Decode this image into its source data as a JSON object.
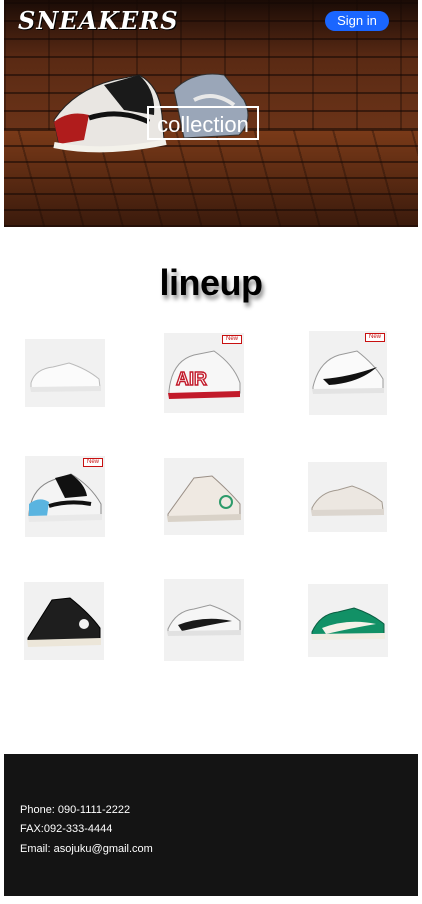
{
  "header": {
    "logo": "SNEAKERS",
    "signin_label": "Sign in"
  },
  "hero": {
    "collection_label": "collection"
  },
  "lineup": {
    "title": "lineup",
    "products": [
      {
        "badge": ""
      },
      {
        "badge": "New"
      },
      {
        "badge": "New"
      },
      {
        "badge": "New"
      },
      {
        "badge": ""
      },
      {
        "badge": ""
      },
      {
        "badge": ""
      },
      {
        "badge": ""
      },
      {
        "badge": ""
      }
    ]
  },
  "footer": {
    "phone": "Phone: 090-1111-2222",
    "fax": "FAX:092-333-4444",
    "email": "Email: asojuku@gmail.com"
  },
  "colors": {
    "signin_button": "#1a66ff",
    "footer_bg": "#141414",
    "badge_red": "#c81010"
  }
}
